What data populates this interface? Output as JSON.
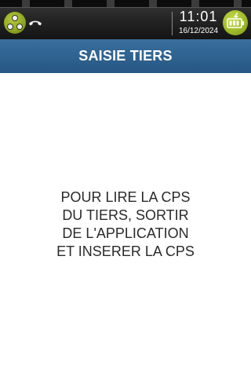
{
  "status_bar": {
    "time": "11:01",
    "date": "16/12/2024",
    "icons": {
      "network": "network-icon",
      "phone": "phone-hangup-icon",
      "battery": "battery-charging-icon"
    },
    "colors": {
      "icon_green": "#9fbb28",
      "bar_dark": "#1c1c1c"
    }
  },
  "title_bar": {
    "title": "SAISIE TIERS",
    "color": "#2f6390"
  },
  "message": {
    "lines": [
      "POUR LIRE LA CPS",
      "DU TIERS, SORTIR",
      "DE L'APPLICATION",
      "ET INSERER LA CPS"
    ]
  }
}
